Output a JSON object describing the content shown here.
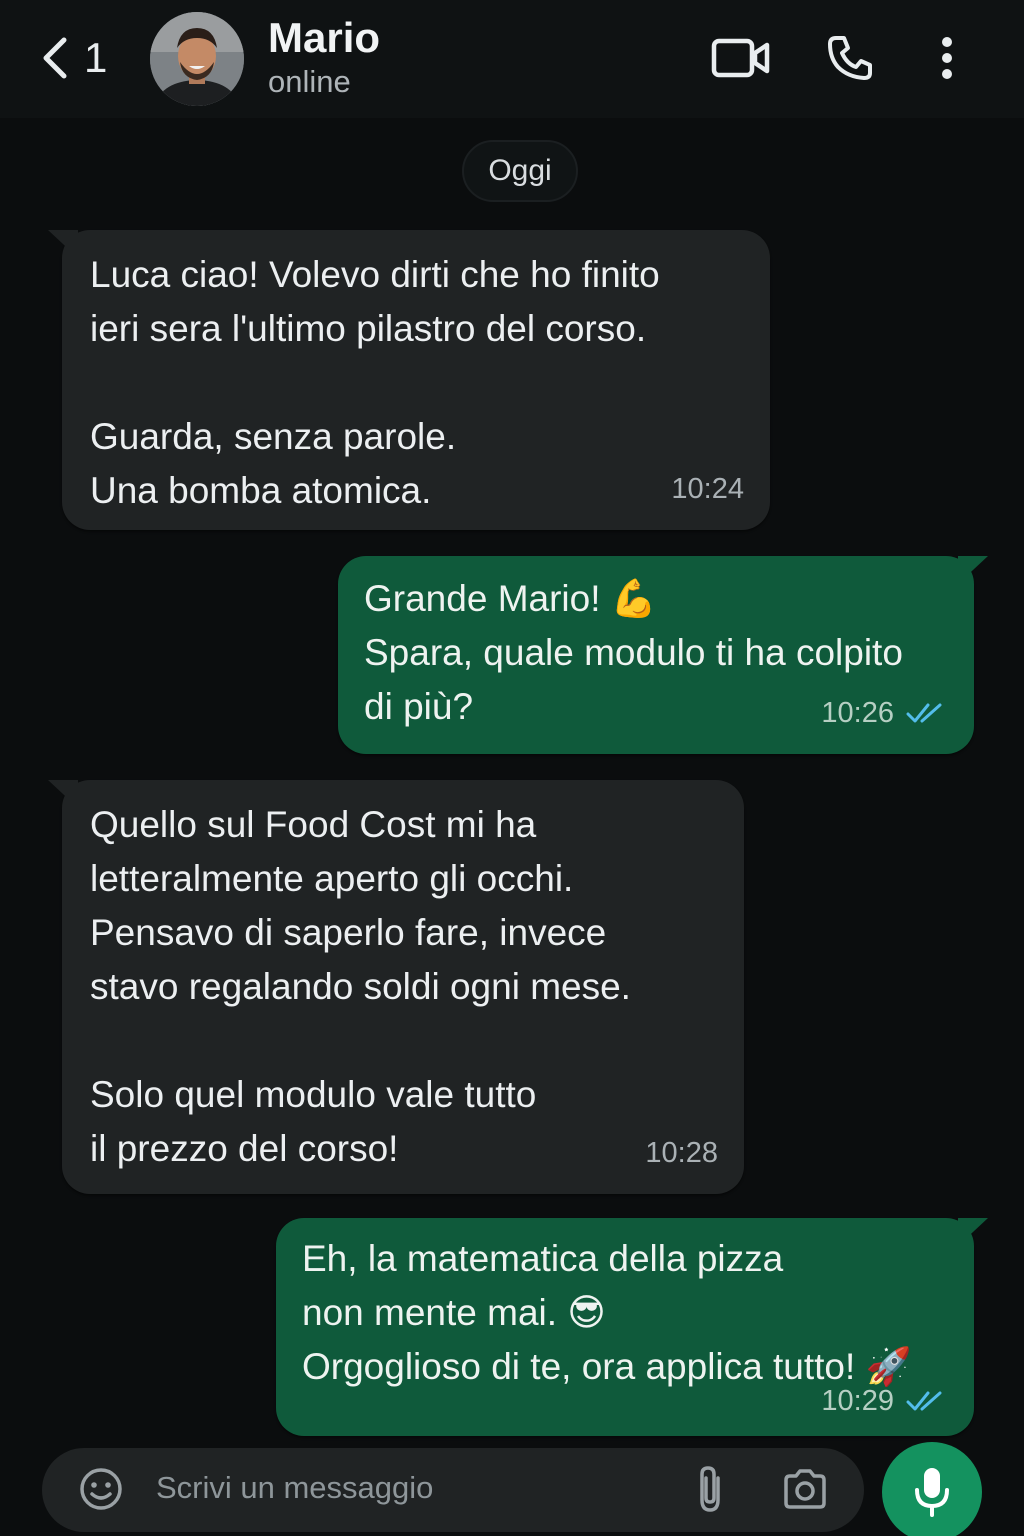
{
  "header": {
    "back_count": "1",
    "contact_name": "Mario",
    "status": "online"
  },
  "chat": {
    "date_label": "Oggi",
    "messages": [
      {
        "direction": "incoming",
        "text": "Luca ciao! Volevo dirti che ho finito\nieri sera l'ultimo pilastro del corso.\n\nGuarda, senza parole.\nUna bomba atomica.",
        "time": "10:24"
      },
      {
        "direction": "outgoing",
        "text": "Grande Mario! 💪\nSpara, quale modulo ti ha colpito\ndi più?",
        "time": "10:26",
        "status": "read"
      },
      {
        "direction": "incoming",
        "text": "Quello sul Food Cost mi ha\nletteralmente aperto gli occhi.\nPensavo di saperlo fare, invece\nstavo regalando soldi ogni mese.\n\nSolo quel modulo vale tutto\nil prezzo del corso!",
        "time": "10:28"
      },
      {
        "direction": "outgoing",
        "text": "Eh, la matematica della pizza\nnon mente mai. 😎\nOrgoglioso di te, ora applica tutto! 🚀",
        "time": "10:29",
        "status": "read"
      }
    ]
  },
  "composer": {
    "placeholder": "Scrivi un messaggio"
  },
  "icons": {
    "back": "chevron-left-icon",
    "video": "video-call-icon",
    "call": "phone-icon",
    "menu": "more-vertical-icon",
    "emoji": "emoji-icon",
    "attach": "paperclip-icon",
    "camera": "camera-icon",
    "mic": "microphone-icon",
    "read": "double-check-icon"
  },
  "colors": {
    "incoming_bubble": "#202324",
    "outgoing_bubble": "#0f5a3b",
    "read_ticks": "#53bdeb",
    "mic_button": "#14925f"
  }
}
